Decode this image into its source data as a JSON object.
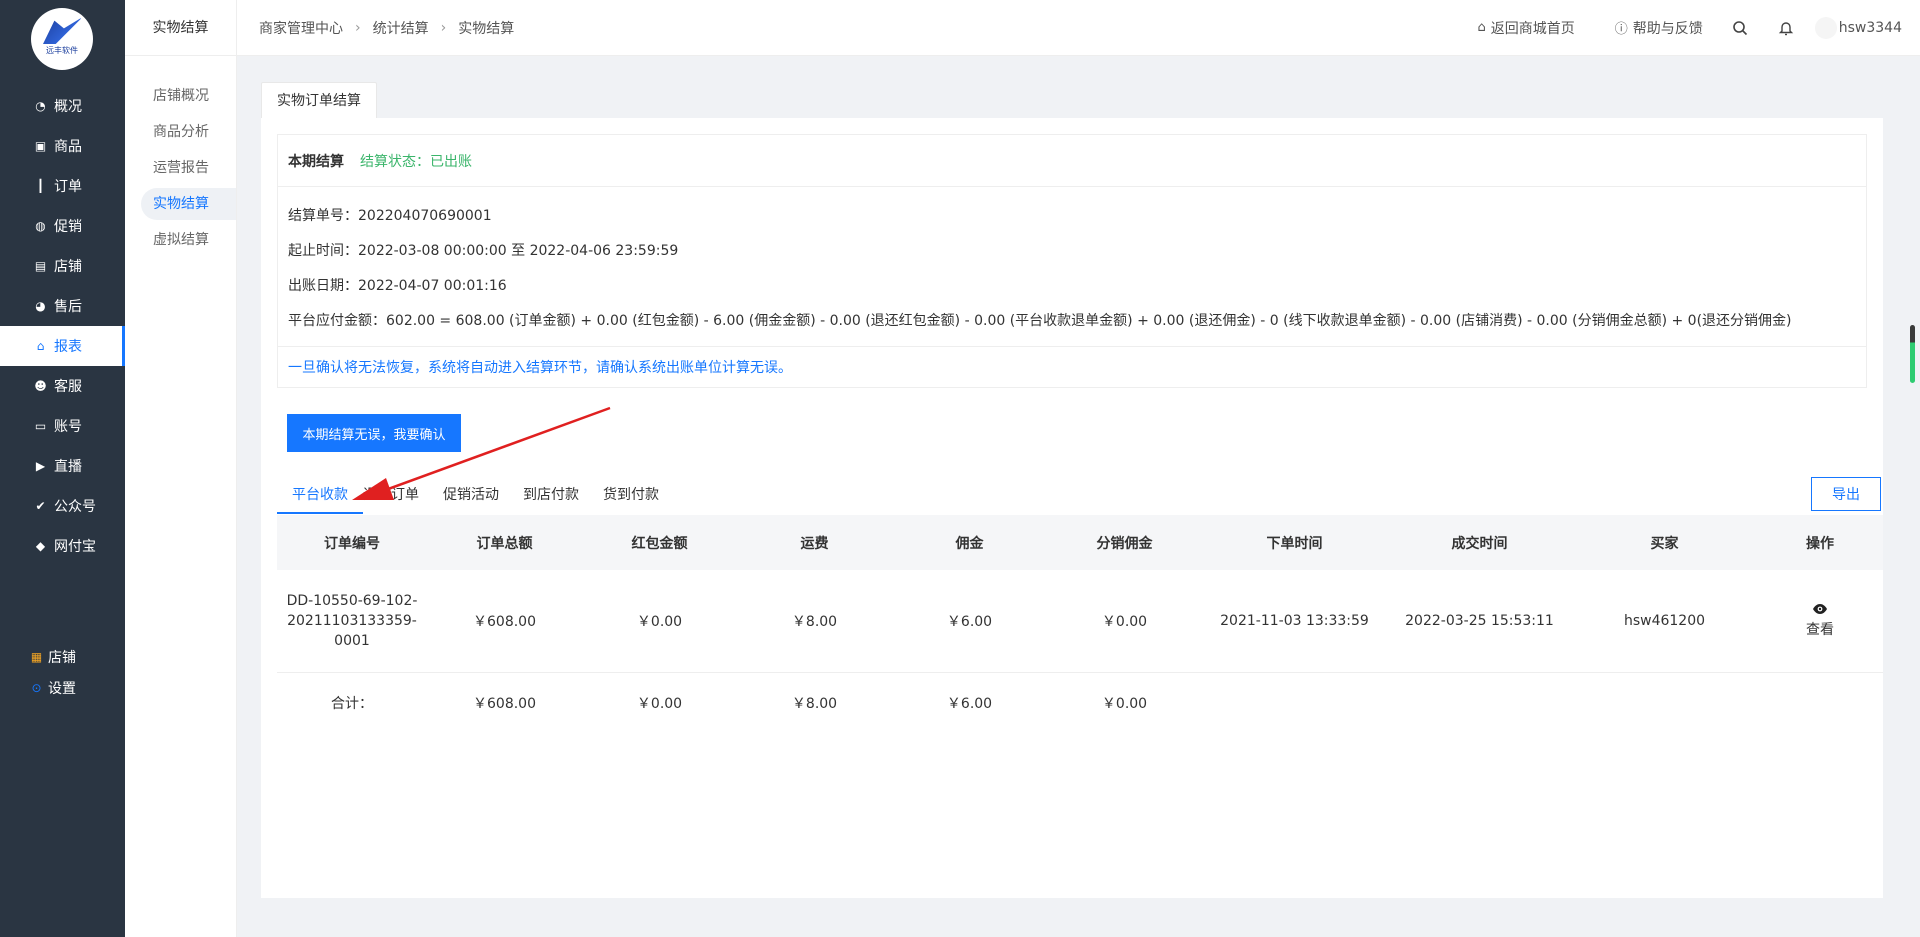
{
  "logo": {
    "text": "远丰软件"
  },
  "menu": [
    {
      "label": "概况",
      "icon": "dashboard-icon"
    },
    {
      "label": "商品",
      "icon": "bag-icon"
    },
    {
      "label": "订单",
      "icon": "bar-chart-icon"
    },
    {
      "label": "促销",
      "icon": "promo-icon"
    },
    {
      "label": "店铺",
      "icon": "store-icon"
    },
    {
      "label": "售后",
      "icon": "aftersale-icon"
    },
    {
      "label": "报表",
      "icon": "report-icon",
      "active": true
    },
    {
      "label": "客服",
      "icon": "service-icon"
    },
    {
      "label": "账号",
      "icon": "card-icon"
    },
    {
      "label": "直播",
      "icon": "live-icon"
    },
    {
      "label": "公众号",
      "icon": "wechat-icon"
    },
    {
      "label": "网付宝",
      "icon": "shield-icon"
    }
  ],
  "menu_bottom": [
    {
      "label": "店铺",
      "icon": "grid-icon"
    },
    {
      "label": "设置",
      "icon": "settings-icon"
    }
  ],
  "subside": {
    "title": "实物结算",
    "items": [
      "店铺概况",
      "商品分析",
      "运营报告",
      "实物结算",
      "虚拟结算"
    ]
  },
  "header": {
    "breadcrumb": [
      "商家管理中心",
      "统计结算",
      "实物结算"
    ],
    "home_link": "返回商城首页",
    "help_link": "帮助与反馈",
    "username": "hsw3344"
  },
  "tab": "实物订单结算",
  "info": {
    "title": "本期结算",
    "status": "结算状态：已出账",
    "lines": [
      "结算单号：202204070690001",
      "起止时间：2022-03-08 00:00:00 至 2022-04-06 23:59:59",
      "出账日期：2022-04-07 00:01:16",
      "平台应付金额：602.00 = 608.00 (订单金额) + 0.00 (红包金额) - 6.00 (佣金金额) - 0.00 (退还红包金额) - 0.00 (平台收款退单金额) + 0.00 (退还佣金) - 0 (线下收款退单金额) - 0.00 (店铺消费) - 0.00 (分销佣金总额) + 0(退还分销佣金)"
    ],
    "notice": "一旦确认将无法恢复，系统将自动进入结算环节，请确认系统出账单位计算无误。"
  },
  "confirm_button": "本期结算无误，我要确认",
  "tabs2": [
    "平台收款",
    "退款订单",
    "促销活动",
    "到店付款",
    "货到付款"
  ],
  "export_button": "导出",
  "table": {
    "headers": [
      "订单编号",
      "订单总额",
      "红包金额",
      "运费",
      "佣金",
      "分销佣金",
      "下单时间",
      "成交时间",
      "买家",
      "操作"
    ],
    "row": {
      "order_no": "DD-10550-69-102-20211103133359-0001",
      "total": "￥608.00",
      "redpack": "￥0.00",
      "freight": "￥8.00",
      "commission": "￥6.00",
      "dist_commission": "￥0.00",
      "order_time": "2021-11-03 13:33:59",
      "deal_time": "2022-03-25 15:53:11",
      "buyer": "hsw461200",
      "action": "查看"
    },
    "total_row": {
      "label": "合计：",
      "total": "￥608.00",
      "redpack": "￥0.00",
      "freight": "￥8.00",
      "commission": "￥6.00",
      "dist_commission": "￥0.00"
    }
  }
}
